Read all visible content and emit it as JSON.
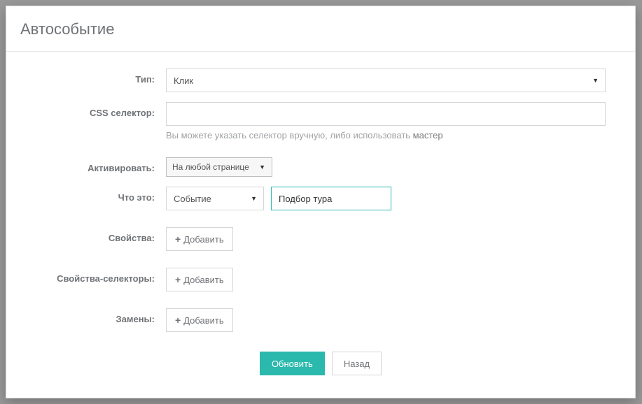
{
  "modal": {
    "title": "Автособытие"
  },
  "labels": {
    "type": "Тип:",
    "css_selector": "CSS селектор:",
    "activate": "Активировать:",
    "what_is": "Что это:",
    "properties": "Свойства:",
    "property_selectors": "Свойства-селекторы:",
    "replacements": "Замены:"
  },
  "fields": {
    "type_value": "Клик",
    "css_selector_value": "",
    "activate_value": "На любой странице",
    "what_is_kind_value": "Событие",
    "what_is_name_value": "Подбор тура"
  },
  "hint": {
    "text_prefix": "Вы можете указать селектор вручную, либо использовать ",
    "link_text": "мастер"
  },
  "buttons": {
    "add": "Добавить",
    "update": "Обновить",
    "back": "Назад"
  }
}
